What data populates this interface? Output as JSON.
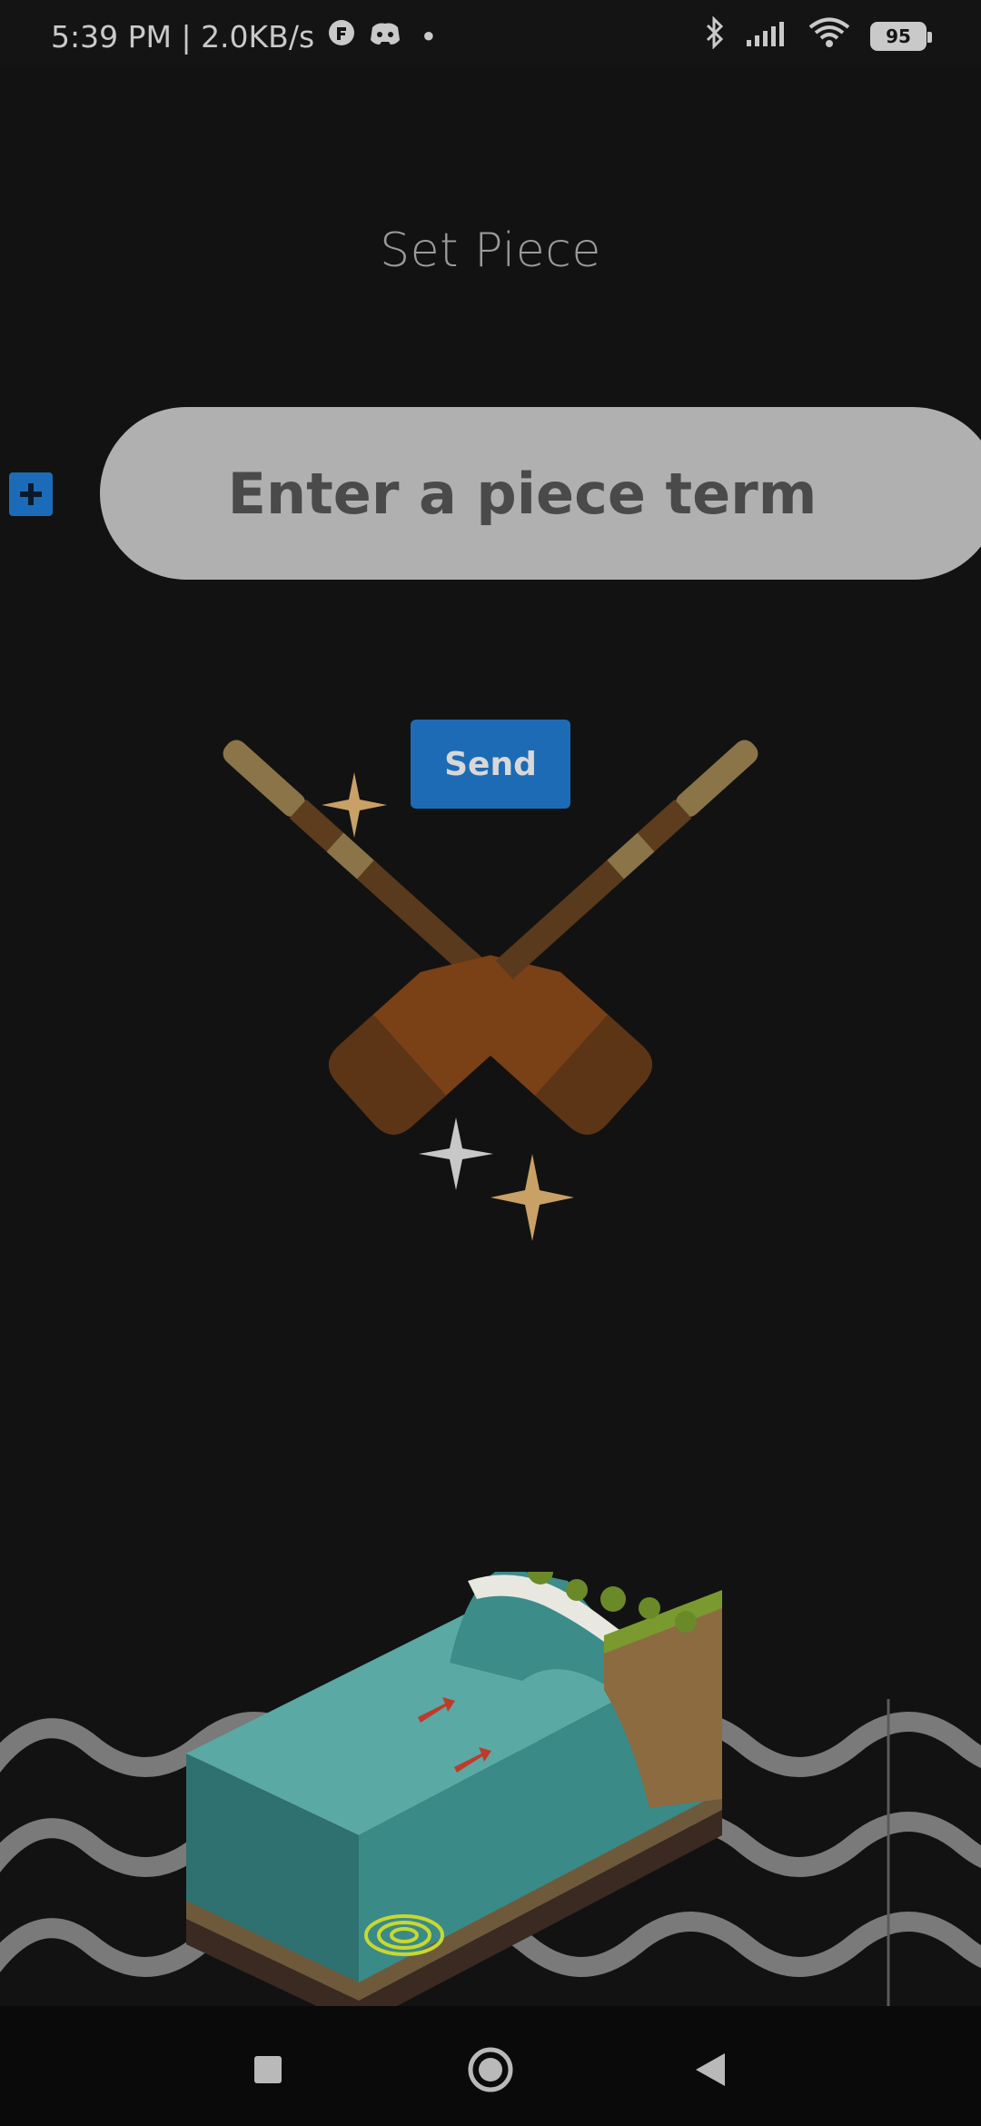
{
  "status_bar": {
    "time_speed": "5:39 PM | 2.0KB/s",
    "dot": "•",
    "battery_level": "95"
  },
  "page": {
    "title": "Set Piece"
  },
  "form": {
    "input_placeholder": "Enter a piece term",
    "input_value": "",
    "send_label": "Send",
    "add_symbol": "+"
  },
  "colors": {
    "background": "#121212",
    "accent_blue": "#1e6bb5",
    "input_bg": "#b0b0b0"
  },
  "icons": {
    "add": "plus-icon",
    "nav_recent": "square-icon",
    "nav_home": "circle-icon",
    "nav_back": "triangle-back-icon"
  }
}
